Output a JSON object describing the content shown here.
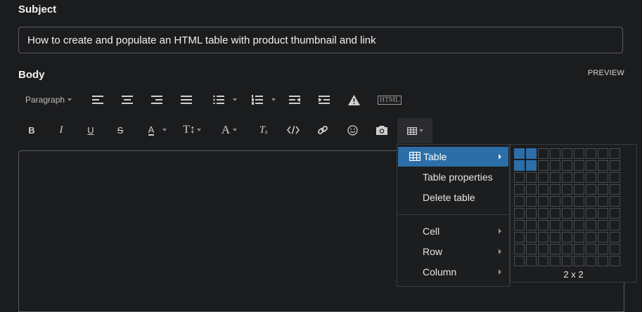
{
  "subject": {
    "label": "Subject",
    "value": "How to create and populate an HTML table with product thumbnail and link"
  },
  "body": {
    "label": "Body",
    "preview_label": "PREVIEW"
  },
  "toolbar": {
    "paragraph_label": "Paragraph",
    "html_label": "HTML",
    "icons_row1": [
      "align-left-icon",
      "align-center-icon",
      "align-right-icon",
      "align-justify-icon",
      "bullet-list-icon",
      "numbered-list-icon",
      "outdent-icon",
      "indent-icon",
      "warning-icon",
      "html-icon"
    ],
    "icons_row2": [
      "bold-icon",
      "italic-icon",
      "underline-icon",
      "strikethrough-icon",
      "text-color-icon",
      "font-size-icon",
      "font-family-icon",
      "clear-format-icon",
      "code-icon",
      "link-icon",
      "emoji-icon",
      "camera-icon",
      "table-icon"
    ],
    "bold_label": "B",
    "italic_label": "I",
    "underline_label": "U",
    "strike_label": "S",
    "text_color_label": "A",
    "font_size_label": "T↕",
    "font_family_label": "A",
    "clear_label": "Tₓ"
  },
  "table_menu": {
    "items": [
      {
        "label": "Table",
        "active": true,
        "submenu": true
      },
      {
        "label": "Table properties",
        "active": false,
        "submenu": false
      },
      {
        "label": "Delete table",
        "active": false,
        "submenu": false
      },
      {
        "label": "Cell",
        "active": false,
        "submenu": true
      },
      {
        "label": "Row",
        "active": false,
        "submenu": true
      },
      {
        "label": "Column",
        "active": false,
        "submenu": true
      }
    ]
  },
  "grid_picker": {
    "columns": 9,
    "rows": 10,
    "selected_cols": 2,
    "selected_rows": 2,
    "size_label": "2 x 2"
  },
  "colors": {
    "accent": "#2b6ea8",
    "background": "#1b1c1e",
    "border": "#5a5b5f"
  }
}
